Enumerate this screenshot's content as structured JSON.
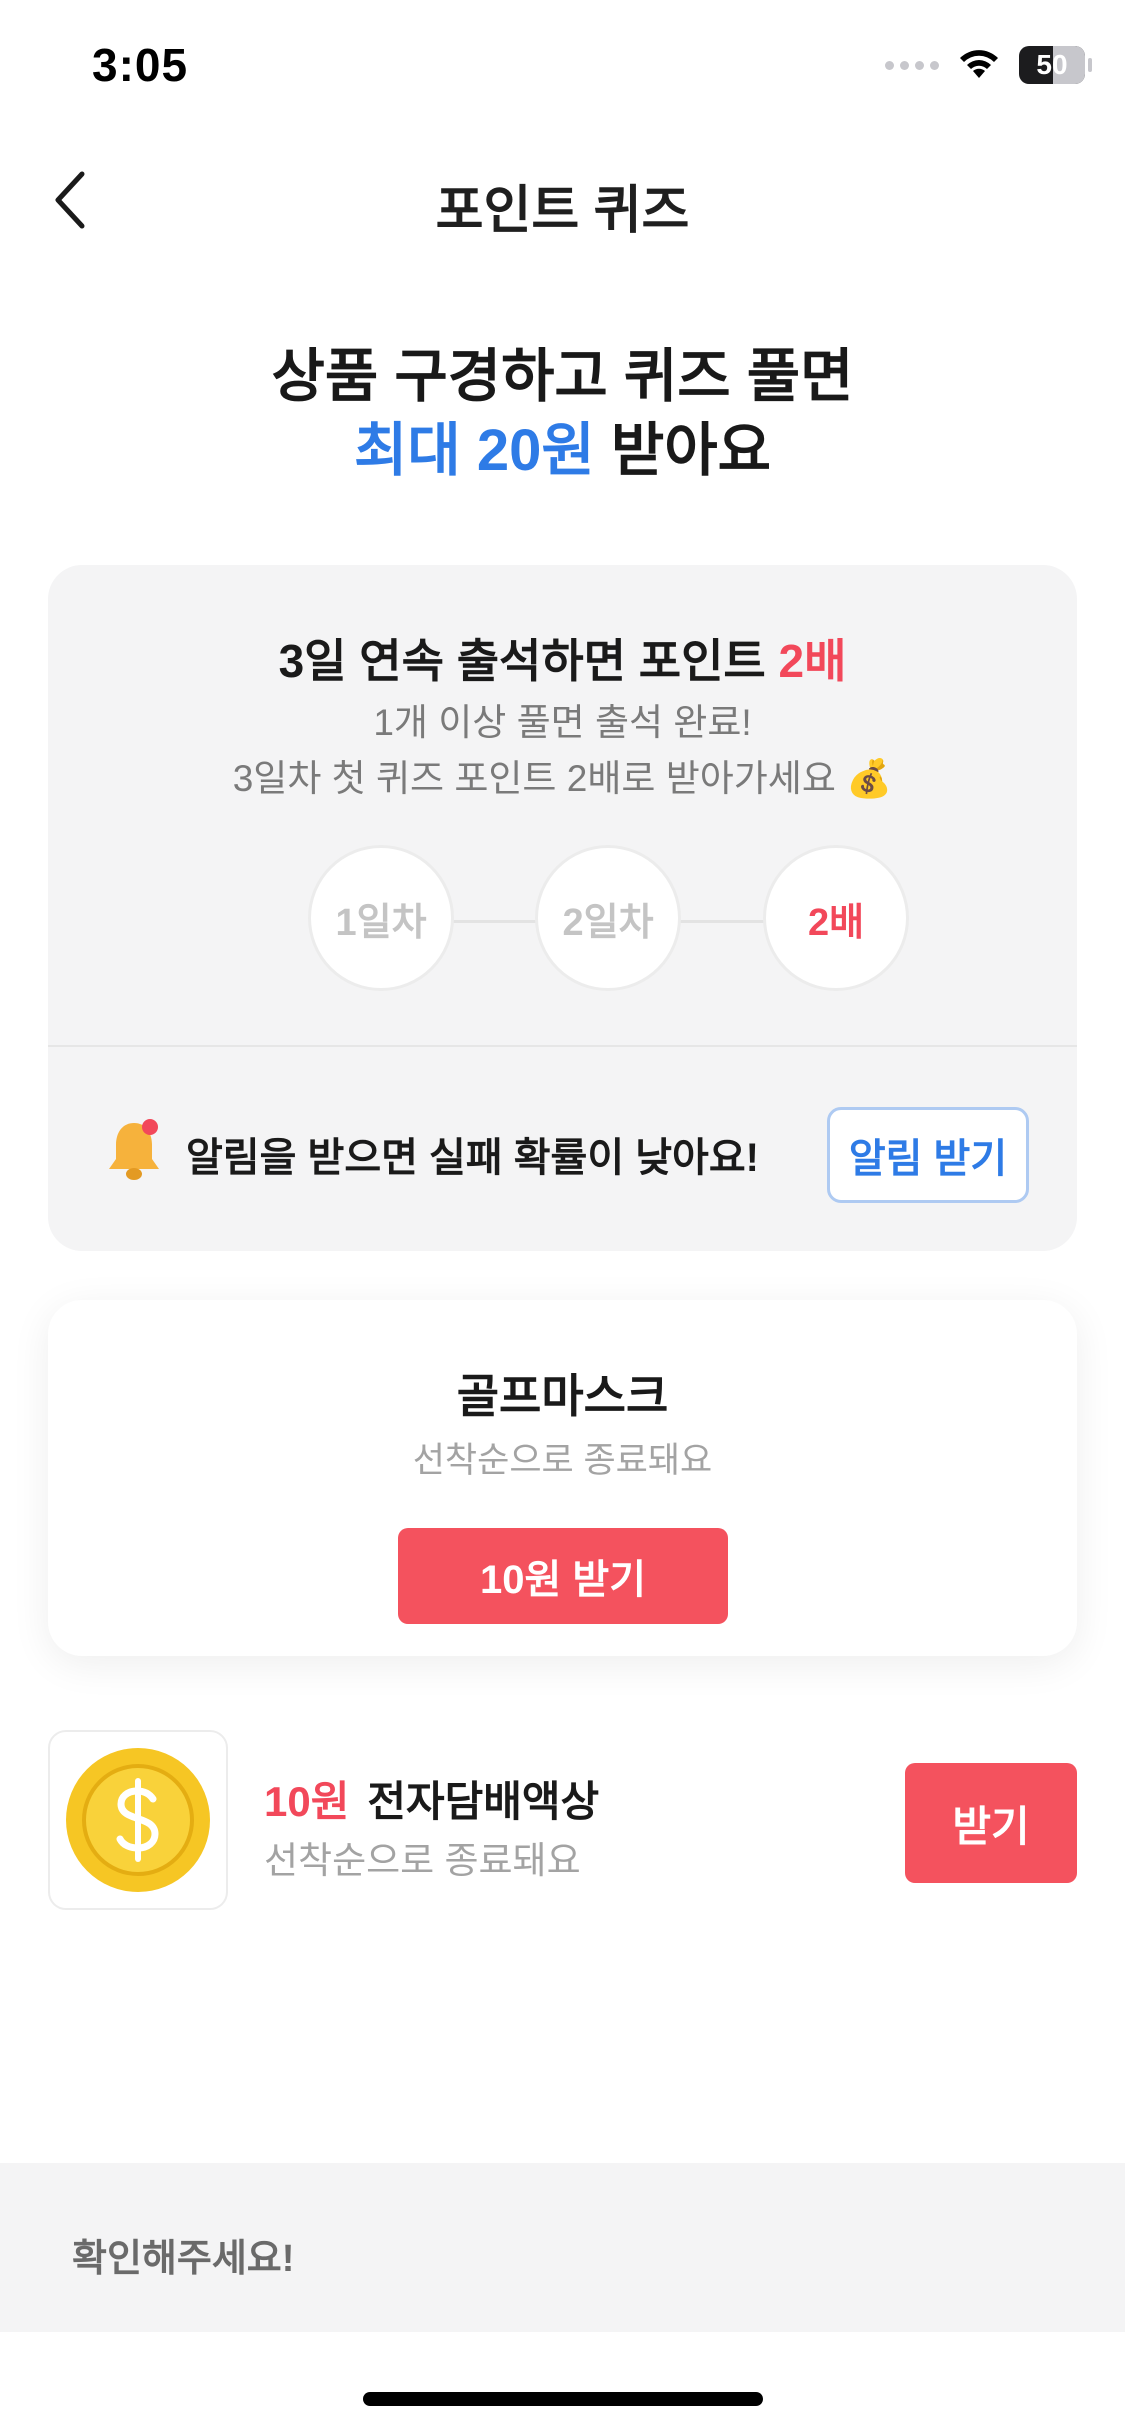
{
  "status_bar": {
    "time": "3:05",
    "battery": "50"
  },
  "header": {
    "title": "포인트 퀴즈",
    "back_icon": "chevron-left-icon"
  },
  "hero": {
    "line1": "상품 구경하고 퀴즈 풀면",
    "line2_accent": "최대 20원",
    "line2_rest": " 받아요"
  },
  "attendance": {
    "title_prefix": "3일 연속 출석하면 포인트 ",
    "title_accent": "2배",
    "subtitle_line1": "1개 이상 풀면 출석 완료!",
    "subtitle_line2": "3일차 첫 퀴즈 포인트 2배로 받아가세요 💰",
    "steps": [
      "1일차",
      "2일차",
      "2배"
    ],
    "alarm_text": "알림을 받으면 실패 확률이 낮아요!",
    "alarm_button": "알림 받기"
  },
  "quiz_card": {
    "title": "골프마스크",
    "subtitle": "선착순으로 종료돼요",
    "button": "10원 받기"
  },
  "list_item": {
    "reward": "10원",
    "name": "전자담배액상",
    "subtitle": "선착순으로 종료돼요",
    "button": "받기",
    "thumb_icon": "dollar-coin-icon"
  },
  "notice": {
    "title": "확인해주세요!"
  },
  "colors": {
    "accent_blue": "#2e7be6",
    "accent_red": "#f2485a",
    "button_red": "#f4525e"
  }
}
